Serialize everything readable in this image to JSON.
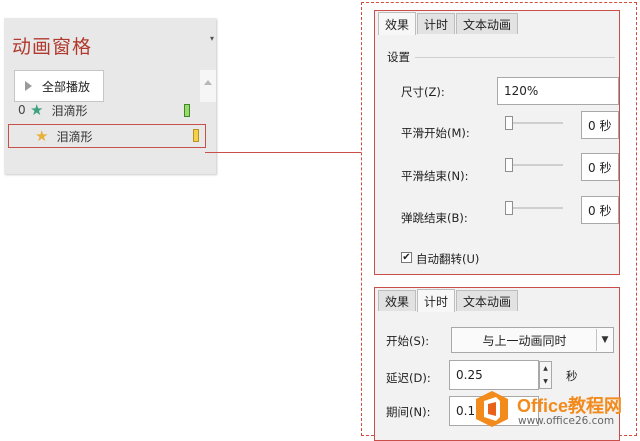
{
  "animation_pane": {
    "title": "动画窗格",
    "dropdown_glyph": "▾",
    "play_all_label": "全部播放",
    "items": [
      {
        "number": "0",
        "star": "★",
        "name": "泪滴形"
      },
      {
        "number": "",
        "star": "★",
        "name": "泪滴形"
      }
    ]
  },
  "effect_dialog": {
    "tabs": [
      "效果",
      "计时",
      "文本动画"
    ],
    "settings_header": "设置",
    "size_label": "尺寸(Z):",
    "size_value": "120%",
    "smooth_start_label": "平滑开始(M):",
    "smooth_start_value": "0 秒",
    "smooth_end_label": "平滑结束(N):",
    "smooth_end_value": "0 秒",
    "bounce_end_label": "弹跳结束(B):",
    "bounce_end_value": "0 秒",
    "auto_reverse_label": "自动翻转(U)",
    "auto_reverse_checked": "✔"
  },
  "timing_dialog": {
    "tabs": [
      "效果",
      "计时",
      "文本动画"
    ],
    "start_label": "开始(S):",
    "start_value": "与上一动画同时",
    "delay_label": "延迟(D):",
    "delay_value": "0.25",
    "delay_unit": "秒",
    "duration_label": "期间(N):",
    "duration_value": "0.13"
  },
  "watermark": {
    "brand": "Office教程网",
    "url": "www.office26.com"
  },
  "colors": {
    "accent_red": "#c9504a",
    "title_red": "#b03a2e",
    "star_green": "#3fa081",
    "star_yellow": "#e8b13a",
    "brand_orange": "#f28a1c"
  }
}
